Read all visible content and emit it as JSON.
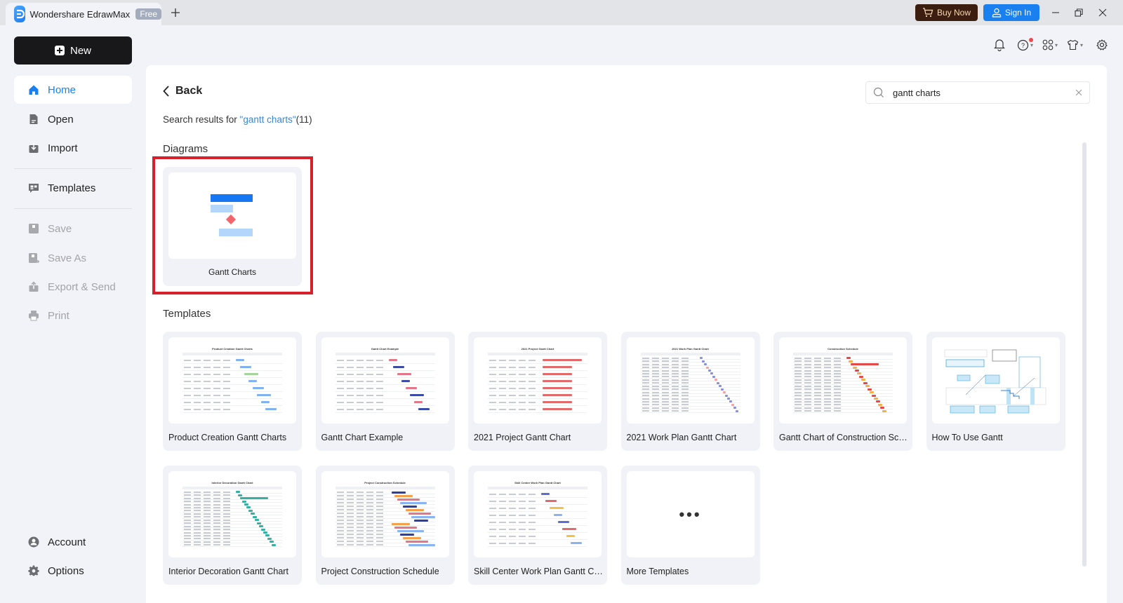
{
  "titlebar": {
    "app_title": "Wondershare EdrawMax",
    "badge": "Free",
    "buy_now": "Buy Now",
    "sign_in": "Sign In"
  },
  "sidebar": {
    "new_label": "New",
    "items": [
      {
        "label": "Home",
        "icon": "home-icon",
        "state": "active"
      },
      {
        "label": "Open",
        "icon": "file-icon",
        "state": "normal"
      },
      {
        "label": "Import",
        "icon": "import-icon",
        "state": "normal"
      },
      {
        "label": "Templates",
        "icon": "templates-icon",
        "state": "normal"
      },
      {
        "label": "Save",
        "icon": "save-icon",
        "state": "disabled"
      },
      {
        "label": "Save As",
        "icon": "save-as-icon",
        "state": "disabled"
      },
      {
        "label": "Export & Send",
        "icon": "export-icon",
        "state": "disabled"
      },
      {
        "label": "Print",
        "icon": "print-icon",
        "state": "disabled"
      }
    ],
    "bottom_items": [
      {
        "label": "Account",
        "icon": "account-icon"
      },
      {
        "label": "Options",
        "icon": "options-gear-icon"
      }
    ]
  },
  "main": {
    "back_label": "Back",
    "search": {
      "value": "gantt charts",
      "summary_prefix": "Search results for ",
      "summary_query": "\"gantt charts\"",
      "summary_count": "(11)"
    },
    "diagrams_title": "Diagrams",
    "diagrams": [
      {
        "label": "Gantt Charts"
      }
    ],
    "templates_title": "Templates",
    "templates": [
      {
        "label": "Product Creation Gantt  Charts",
        "thumb_title": "Product Creation Gantt Charts"
      },
      {
        "label": "Gantt Chart Example",
        "thumb_title": "Gantt Chart Example"
      },
      {
        "label": "2021 Project Gantt Chart",
        "thumb_title": "2021 Project Gantt Chart"
      },
      {
        "label": "2021 Work Plan Gantt Chart",
        "thumb_title": "2021 Work Plan Gantt Chart"
      },
      {
        "label": "Gantt Chart of Construction Sch...",
        "thumb_title": "Construction Schedule"
      },
      {
        "label": "How To Use Gantt",
        "thumb_title": ""
      },
      {
        "label": "Interior Decoration Gantt Chart",
        "thumb_title": "Interior Decoration Gantt Chart"
      },
      {
        "label": "Project Construction Schedule",
        "thumb_title": "Project Construction Schedule"
      },
      {
        "label": "Skill Center Work Plan Gantt Chart",
        "thumb_title": "Skill Center Work Plan Gantt Chart"
      },
      {
        "label": "More Templates",
        "thumb_title": "..."
      }
    ]
  },
  "colors": {
    "accent": "#1a80f0",
    "highlight": "#d8202b",
    "buy_bg": "#3b1e0f"
  }
}
